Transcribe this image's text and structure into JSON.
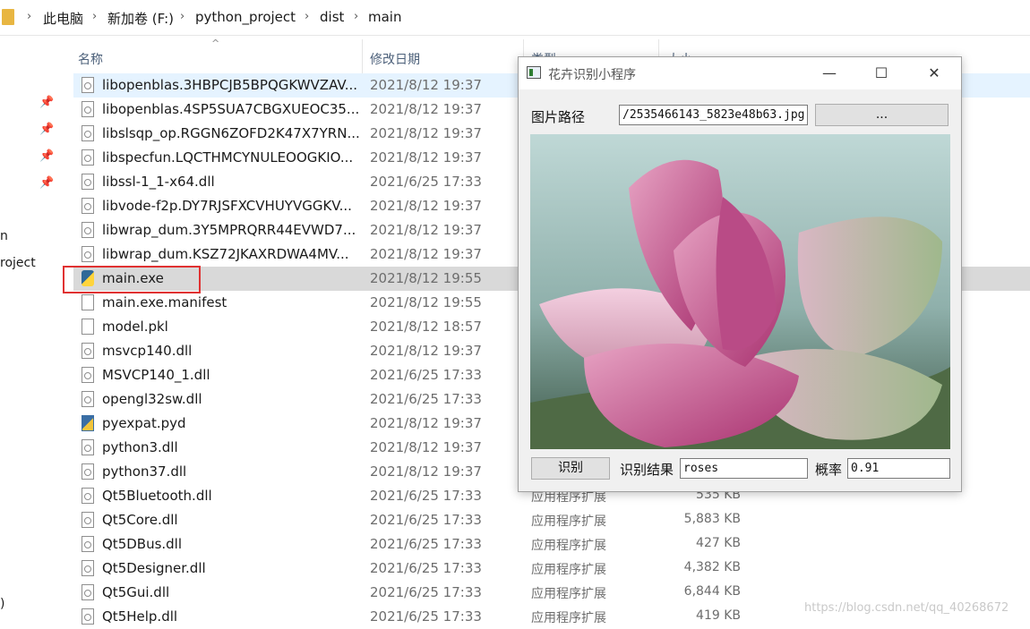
{
  "breadcrumb": [
    "此电脑",
    "新加卷 (F:)",
    "python_project",
    "dist",
    "main"
  ],
  "nav_fragments": [
    "n",
    "roject",
    ")"
  ],
  "columns": {
    "name": "名称",
    "date": "修改日期",
    "type": "类型",
    "size": "大小"
  },
  "files": [
    {
      "name": "libopenblas.3HBPCJB5BPQGKWVZAV...",
      "date": "2021/8/12 19:37",
      "type": "",
      "size": "",
      "icon": "dll"
    },
    {
      "name": "libopenblas.4SP5SUA7CBGXUEOC35...",
      "date": "2021/8/12 19:37",
      "type": "",
      "size": "",
      "icon": "dll"
    },
    {
      "name": "libslsqp_op.RGGN6ZOFD2K47X7YRN...",
      "date": "2021/8/12 19:37",
      "type": "",
      "size": "",
      "icon": "dll"
    },
    {
      "name": "libspecfun.LQCTHMCYNULEOOGKIO...",
      "date": "2021/8/12 19:37",
      "type": "",
      "size": "",
      "icon": "dll"
    },
    {
      "name": "libssl-1_1-x64.dll",
      "date": "2021/6/25 17:33",
      "type": "",
      "size": "",
      "icon": "dll"
    },
    {
      "name": "libvode-f2p.DY7RJSFXCVHUYVGGKV...",
      "date": "2021/8/12 19:37",
      "type": "",
      "size": "",
      "icon": "dll"
    },
    {
      "name": "libwrap_dum.3Y5MPRQRR44EVWD7...",
      "date": "2021/8/12 19:37",
      "type": "",
      "size": "",
      "icon": "dll"
    },
    {
      "name": "libwrap_dum.KSZ72JKAXRDWA4MV...",
      "date": "2021/8/12 19:37",
      "type": "",
      "size": "",
      "icon": "dll"
    },
    {
      "name": "main.exe",
      "date": "2021/8/12 19:55",
      "type": "",
      "size": "",
      "icon": "exe"
    },
    {
      "name": "main.exe.manifest",
      "date": "2021/8/12 19:55",
      "type": "",
      "size": "",
      "icon": "file"
    },
    {
      "name": "model.pkl",
      "date": "2021/8/12 18:57",
      "type": "",
      "size": "",
      "icon": "file"
    },
    {
      "name": "msvcp140.dll",
      "date": "2021/8/12 19:37",
      "type": "",
      "size": "",
      "icon": "dll"
    },
    {
      "name": "MSVCP140_1.dll",
      "date": "2021/6/25 17:33",
      "type": "",
      "size": "",
      "icon": "dll"
    },
    {
      "name": "opengl32sw.dll",
      "date": "2021/6/25 17:33",
      "type": "",
      "size": "",
      "icon": "dll"
    },
    {
      "name": "pyexpat.pyd",
      "date": "2021/8/12 19:37",
      "type": "",
      "size": "",
      "icon": "py"
    },
    {
      "name": "python3.dll",
      "date": "2021/8/12 19:37",
      "type": "",
      "size": "",
      "icon": "dll"
    },
    {
      "name": "python37.dll",
      "date": "2021/8/12 19:37",
      "type": "",
      "size": "",
      "icon": "dll"
    },
    {
      "name": "Qt5Bluetooth.dll",
      "date": "2021/6/25 17:33",
      "type": "应用程序扩展",
      "size": "535 KB",
      "icon": "dll"
    },
    {
      "name": "Qt5Core.dll",
      "date": "2021/6/25 17:33",
      "type": "应用程序扩展",
      "size": "5,883 KB",
      "icon": "dll"
    },
    {
      "name": "Qt5DBus.dll",
      "date": "2021/6/25 17:33",
      "type": "应用程序扩展",
      "size": "427 KB",
      "icon": "dll"
    },
    {
      "name": "Qt5Designer.dll",
      "date": "2021/6/25 17:33",
      "type": "应用程序扩展",
      "size": "4,382 KB",
      "icon": "dll"
    },
    {
      "name": "Qt5Gui.dll",
      "date": "2021/6/25 17:33",
      "type": "应用程序扩展",
      "size": "6,844 KB",
      "icon": "dll"
    },
    {
      "name": "Qt5Help.dll",
      "date": "2021/6/25 17:33",
      "type": "应用程序扩展",
      "size": "419 KB",
      "icon": "dll"
    }
  ],
  "watermark": "https://blog.csdn.net/qq_40268672",
  "app": {
    "title": "花卉识别小程序",
    "path_label": "图片路径",
    "path_value": "/2535466143_5823e48b63.jpg",
    "browse_label": "...",
    "recognize_label": "识别",
    "result_label": "识别结果",
    "result_value": "roses",
    "prob_label": "概率",
    "prob_value": "0.91",
    "min_glyph": "—",
    "max_glyph": "☐",
    "close_glyph": "✕"
  },
  "colors": {
    "highlight_box": "#e03131",
    "hover_row": "#e5f3ff",
    "selected_row": "#d9d9d9"
  }
}
